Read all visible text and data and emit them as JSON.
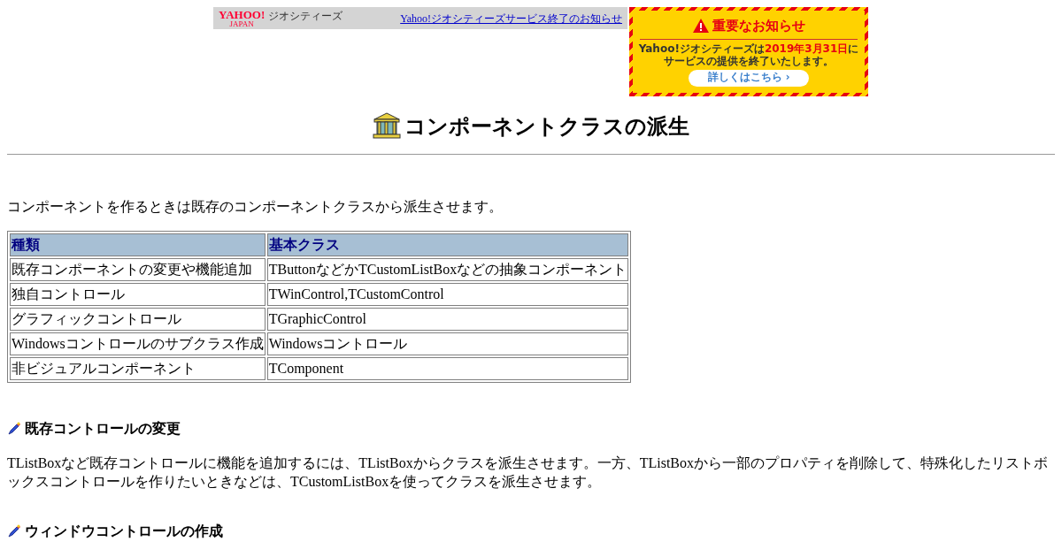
{
  "banner": {
    "logo": "YAHOO!",
    "logo_sub": "JAPAN",
    "service": "ジオシティーズ",
    "link": "Yahoo!ジオシティーズサービス終了のお知らせ"
  },
  "notice": {
    "title": "重要なお知らせ",
    "lines": [
      "Yahoo!ジオシティーズは**2019年3月31日**に",
      "サービスの提供を終了いたします。"
    ],
    "button": "詳しくはこちら ›"
  },
  "page_title": "コンポーネントクラスの派生",
  "intro": "コンポーネントを作るときは既存のコンポーネントクラスから派生させます。",
  "table": {
    "columns": [
      "種類",
      "基本クラス"
    ],
    "rows": [
      [
        "既存コンポーネントの変更や機能追加",
        "TButtonなどかTCustomListBoxなどの抽象コンポーネント"
      ],
      [
        "独自コントロール",
        "TWinControl,TCustomControl"
      ],
      [
        "グラフィックコントロール",
        "TGraphicControl"
      ],
      [
        "Windowsコントロールのサブクラス作成",
        "Windowsコントロール"
      ],
      [
        "非ビジュアルコンポーネント",
        "TComponent"
      ]
    ]
  },
  "sections": [
    {
      "heading": "既存コントロールの変更",
      "text": "TListBoxなど既存コントロールに機能を追加するには、TListBoxからクラスを派生させます。一方、TListBoxから一部のプロパティを削除して、特殊化したリストボックスコントロールを作りたいときなどは、TCustomListBoxを使ってクラスを派生させます。"
    },
    {
      "heading": "ウィンドウコントロールの作成"
    }
  ]
}
